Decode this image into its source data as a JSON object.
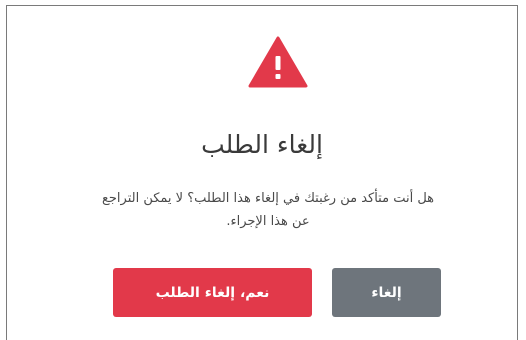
{
  "dialog": {
    "title": "إلغاء الطلب",
    "message_line1": "هل أنت متأكد من رغبتك في إلغاء هذا الطلب؟ لا يمكن التراجع",
    "message_line2": "عن هذا الإجراء.",
    "icon": "warning-icon",
    "confirm_label": "نعم، إلغاء الطلب",
    "cancel_label": "إلغاء"
  },
  "colors": {
    "danger": "#e2394a",
    "secondary": "#6e757c",
    "text": "#3a3a3a"
  }
}
